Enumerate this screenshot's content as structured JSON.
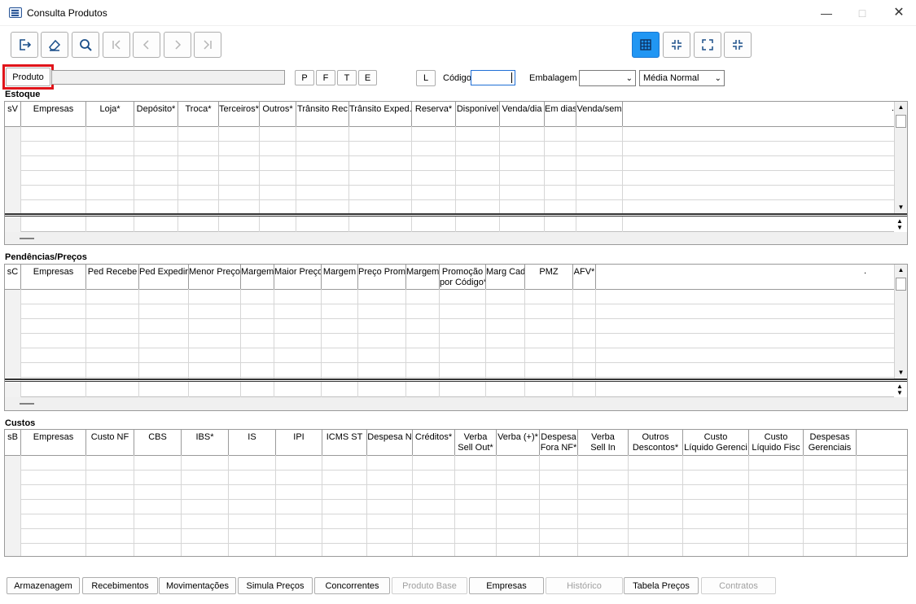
{
  "window": {
    "title": "Consulta Produtos"
  },
  "toolbar": {
    "buttons": [
      {
        "icon": "exit-icon"
      },
      {
        "icon": "eraser-icon"
      },
      {
        "icon": "search-icon"
      },
      {
        "icon": "first-record-icon"
      },
      {
        "icon": "previous-record-icon"
      },
      {
        "icon": "next-record-icon"
      },
      {
        "icon": "last-record-icon"
      }
    ],
    "view_buttons": [
      {
        "icon": "grid-view-icon",
        "active": true
      },
      {
        "icon": "collapse-icon"
      },
      {
        "icon": "expand-icon"
      },
      {
        "icon": "collapse-alt-icon"
      }
    ]
  },
  "filters": {
    "produto_label": "Produto",
    "letters": [
      "P",
      "F",
      "T",
      "E"
    ],
    "l_button": "L",
    "codigo_label": "Código",
    "embalagem_label": "Embalagem",
    "embalagem_value": "",
    "media_value": "Média Normal"
  },
  "estoque": {
    "title": "Estoque",
    "columns": [
      "sV",
      "Empresas",
      "Loja*",
      "Depósito*",
      "Troca*",
      "Terceiros*",
      "Outros*",
      "Trânsito Rec",
      "Trânsito Exped.",
      "Reserva*",
      "Disponível",
      "Venda/dia",
      "Em dias",
      "Venda/sem"
    ],
    "corner_mark": "."
  },
  "pendencias": {
    "title": "Pendências/Preços",
    "columns": [
      "sC",
      "Empresas",
      "Ped Recebe",
      "Ped Expedir",
      "Menor Preço",
      "Margem",
      "Maior Preço",
      "Margem",
      "Preço Prom",
      "Margem",
      "Promoção\npor Código*",
      "Marg Cad",
      "PMZ",
      "AFV*"
    ],
    "corner_mark": "."
  },
  "custos": {
    "title": "Custos",
    "columns": [
      "sB",
      "Empresas",
      "Custo NF",
      "CBS",
      "IBS*",
      "IS",
      "IPI",
      "ICMS ST",
      "Despesa N",
      "Créditos*",
      "Verba\nSell Out*",
      "Verba (+)*",
      "Despesa\nFora NF*",
      "Verba\nSell In",
      "Outros\nDescontos*",
      "Custo\nLíquido Gerenci",
      "Custo\nLíquido Fisc",
      "Despesas\nGerenciais"
    ]
  },
  "bottom_buttons": [
    {
      "label": "Armazenagem",
      "enabled": true
    },
    {
      "label": "Recebimentos",
      "enabled": true
    },
    {
      "label": "Movimentações",
      "enabled": true
    },
    {
      "label": "Simula Preços",
      "enabled": true
    },
    {
      "label": "Concorrentes",
      "enabled": true
    },
    {
      "label": "Produto Base",
      "enabled": false
    },
    {
      "label": "Empresas",
      "enabled": true
    },
    {
      "label": "Histórico",
      "enabled": false
    },
    {
      "label": "Tabela Preços",
      "enabled": true
    },
    {
      "label": "Contratos",
      "enabled": false
    }
  ]
}
